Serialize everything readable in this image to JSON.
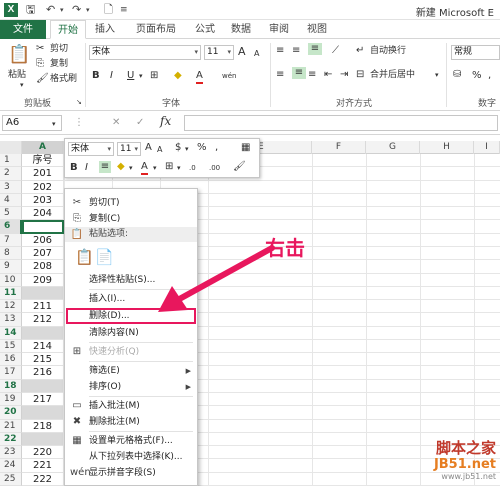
{
  "window": {
    "title": "新建 Microsoft E"
  },
  "quick_access": {
    "logo": "X",
    "save": "🖫",
    "undo": "↶",
    "redo": "↷",
    "file_icon": "🗋"
  },
  "tabs": [
    "文件",
    "开始",
    "插入",
    "页面布局",
    "公式",
    "数据",
    "审阅",
    "视图"
  ],
  "ribbon": {
    "clipboard": {
      "paste": "粘贴",
      "cut": "剪切",
      "copy": "复制",
      "format_painter": "格式刷",
      "label": "剪贴板"
    },
    "font": {
      "name": "宋体",
      "size": "11",
      "bold": "B",
      "italic": "I",
      "underline": "U",
      "grow": "A",
      "shrink": "A",
      "wen": "wén",
      "label": "字体"
    },
    "alignment": {
      "wrap": "自动换行",
      "merge": "合并后居中",
      "label": "对齐方式"
    },
    "number": {
      "format": "常规",
      "percent": "%",
      "comma": ",",
      "label": "数字"
    }
  },
  "formula_bar": {
    "name_box": "A6",
    "fx": "fx",
    "cancel": "✕",
    "enter": "✓"
  },
  "columns": [
    "A",
    "B",
    "C",
    "D",
    "E",
    "F",
    "G",
    "H",
    "I"
  ],
  "rows": [
    {
      "num": "1",
      "value": "序号",
      "gray": false
    },
    {
      "num": "2",
      "value": "201",
      "gray": false
    },
    {
      "num": "3",
      "value": "202",
      "gray": false
    },
    {
      "num": "4",
      "value": "203",
      "gray": false
    },
    {
      "num": "5",
      "value": "204",
      "gray": false
    },
    {
      "num": "6",
      "value": "",
      "gray": false
    },
    {
      "num": "7",
      "value": "206",
      "gray": false
    },
    {
      "num": "8",
      "value": "207",
      "gray": false
    },
    {
      "num": "9",
      "value": "208",
      "gray": false
    },
    {
      "num": "10",
      "value": "209",
      "gray": false
    },
    {
      "num": "11",
      "value": "",
      "gray": true
    },
    {
      "num": "12",
      "value": "211",
      "gray": false
    },
    {
      "num": "13",
      "value": "212",
      "gray": false
    },
    {
      "num": "14",
      "value": "",
      "gray": true
    },
    {
      "num": "15",
      "value": "214",
      "gray": false
    },
    {
      "num": "16",
      "value": "215",
      "gray": false
    },
    {
      "num": "17",
      "value": "216",
      "gray": false
    },
    {
      "num": "18",
      "value": "",
      "gray": true
    },
    {
      "num": "19",
      "value": "217",
      "gray": false
    },
    {
      "num": "20",
      "value": "",
      "gray": true
    },
    {
      "num": "21",
      "value": "218",
      "gray": false
    },
    {
      "num": "22",
      "value": "",
      "gray": true
    },
    {
      "num": "23",
      "value": "220",
      "gray": false
    },
    {
      "num": "24",
      "value": "221",
      "gray": false
    },
    {
      "num": "25",
      "value": "222",
      "gray": false
    }
  ],
  "mini_toolbar": {
    "font": "宋体",
    "size": "11",
    "grow": "A",
    "shrink": "A",
    "currency": "$",
    "percent": "%",
    "comma": ",",
    "bold": "B",
    "italic": "I",
    "font_color": "A",
    "decimals_inc": ".0",
    "decimals_dec": ".00"
  },
  "context_menu": [
    {
      "label": "剪切(T)",
      "icon": "✂",
      "type": "item"
    },
    {
      "label": "复制(C)",
      "icon": "⎘",
      "type": "item"
    },
    {
      "label": "粘贴选项:",
      "icon": "📋",
      "type": "header"
    },
    {
      "label": "",
      "icon": "",
      "type": "paste-icons"
    },
    {
      "label": "选择性粘贴(S)...",
      "icon": "",
      "type": "item"
    },
    {
      "label": "插入(I)...",
      "icon": "",
      "type": "item"
    },
    {
      "label": "删除(D)...",
      "icon": "",
      "type": "highlight"
    },
    {
      "label": "清除内容(N)",
      "icon": "",
      "type": "item"
    },
    {
      "label": "快速分析(Q)",
      "icon": "⊞",
      "type": "disabled"
    },
    {
      "label": "筛选(E)",
      "icon": "",
      "type": "submenu"
    },
    {
      "label": "排序(O)",
      "icon": "",
      "type": "submenu"
    },
    {
      "label": "插入批注(M)",
      "icon": "▭",
      "type": "item"
    },
    {
      "label": "删除批注(M)",
      "icon": "✖",
      "type": "item"
    },
    {
      "label": "设置单元格格式(F)...",
      "icon": "▦",
      "type": "item"
    },
    {
      "label": "从下拉列表中选择(K)...",
      "icon": "",
      "type": "item"
    },
    {
      "label": "显示拼音字段(S)",
      "icon": "wén",
      "type": "item"
    }
  ],
  "annotation": {
    "text": "右击"
  },
  "watermark": {
    "line1": "脚本之家",
    "line2": "JB51.net",
    "line3": "www.jb51.net"
  },
  "colors": {
    "accent": "#217346",
    "annotation": "#e8175d"
  }
}
